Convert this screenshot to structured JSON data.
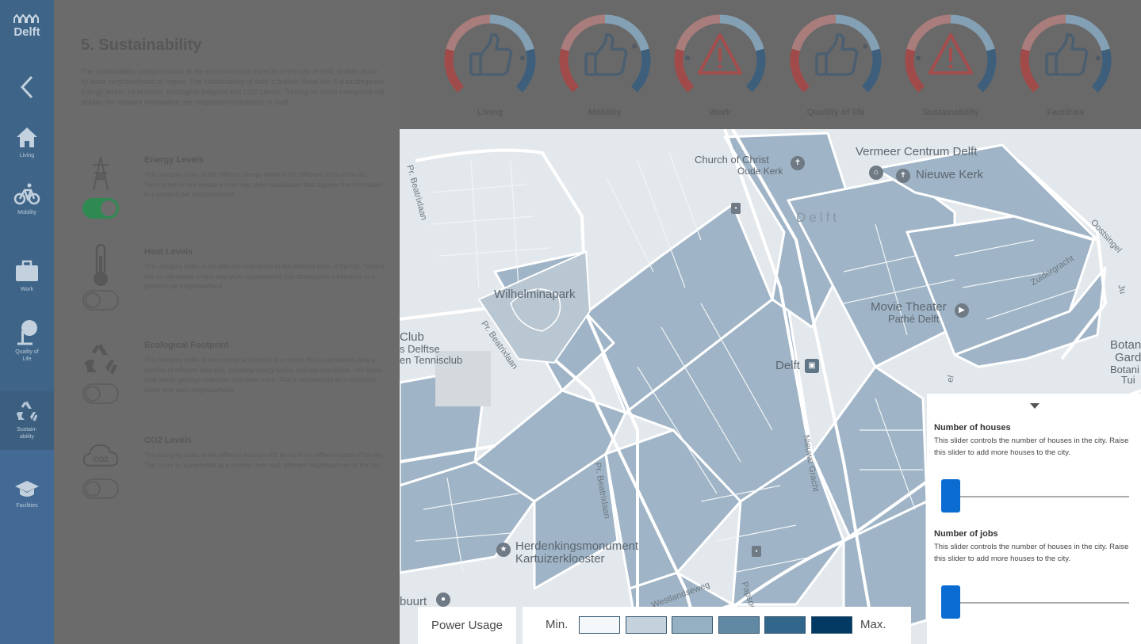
{
  "sidebar": {
    "logo_text": "Delft",
    "items": [
      {
        "label": "Living",
        "icon": "home-icon"
      },
      {
        "label": "Mobility",
        "icon": "bicycle-icon"
      },
      {
        "label": "Work",
        "icon": "briefcase-icon"
      },
      {
        "label": "Quality of Life",
        "icon": "tree-icon"
      },
      {
        "label": "Sustain-ability",
        "icon": "recycle-icon"
      },
      {
        "label": "Facilities",
        "icon": "graduation-cap-icon"
      }
    ]
  },
  "info": {
    "title": "5. Sustainability",
    "intro": "The sustainability category looks at the environmental aspects of the city of delft, broken down by each neighbourhood or region. The sustainability of delft is broken down into 4 subcategories. Energy levels, Heat levels, Ecological footprint and CO2 Levels. Turning on these categories will display the relevant information per neighbourhood/district of Delft",
    "categories": [
      {
        "title": "Energy Levels",
        "description": "This category looks at the different energy levels in the different parts of the city. Turning this on will enable a heat map style visualisation that displays the information in a gradient per neighbourhood",
        "enabled": true,
        "icon": "power-tower-icon"
      },
      {
        "title": "Heat Levels",
        "description": "This category looks at the different heat levels in the different parts of the city. Turning this on will enable a heat map style visualisations that displays the information in a gradient per neighbourhood.",
        "enabled": false,
        "icon": "thermometer-icon"
      },
      {
        "title": "Ecological Footprint",
        "description": "This category looks at the ecological footprint of a region, this is calculated using a number of different data sets, including energy levels, average population, c02 levels, heat levels, garbage collection and many more. This is represented as a numerical score over each neighbourhood.",
        "enabled": false,
        "icon": "recycle-icon"
      },
      {
        "title": "CO2 Levels",
        "description": "This category looks at the different average c02 levels of the different parts of the city. This score is represented as a number over each different neighbourhood of the city.",
        "enabled": false,
        "icon": "cloud-co2-icon",
        "icon_text": "CO2"
      }
    ]
  },
  "scores": [
    {
      "label": "Living",
      "status": "thumbs-up-icon",
      "level": 0.82
    },
    {
      "label": "Mobility",
      "status": "thumbs-up-icon",
      "level": 0.74
    },
    {
      "label": "Work",
      "status": "warning-icon",
      "level": 0.18
    },
    {
      "label": "Quallity of life",
      "status": "thumbs-up-icon",
      "level": 0.74
    },
    {
      "label": "Sustainability",
      "status": "warning-icon",
      "level": 0.18
    },
    {
      "label": "Facilities",
      "status": "thumbs-up-icon",
      "level": 0.82
    }
  ],
  "map": {
    "labels": {
      "church": "Church of Christ",
      "oude_kerk": "Oude Kerk",
      "vermeer": "Vermeer Centrum Delft",
      "nieuwe_kerk": "Nieuwe Kerk",
      "delft": "Delft",
      "wilhelminapark": "Wilhelminapark",
      "movie_theater": "Movie Theater",
      "pathe": "Pathé Delft",
      "delft_station": "Delft",
      "club1": "Club",
      "club2": "s Delftse",
      "club3": "en Tennisclub",
      "botan1": "Botan",
      "botan2": "Gard",
      "botan3": "Botani",
      "botan4": "Tui",
      "herdenking1": "Herdenkingsmonument",
      "herdenking2": "Kartuizerklooster",
      "buurt": "buurt"
    },
    "streets": {
      "beatrixlaan1": "Pr. Beatrixlaan",
      "beatrixlaan2": "Pr. Beatrixlaan",
      "beatrixlaan3": "Pr. Beatrixlaan",
      "nieuwe_gracht": "Nieuwe Gracht",
      "zuidergracht": "Zuidergracht",
      "oostsingel": "Oostsingel",
      "westlandseweg": "Westlandseweg",
      "papsouw": "Papsou",
      "ju": "Ju",
      "el": "el"
    }
  },
  "legend": {
    "title": "Power Usage",
    "min": "Min.",
    "max": "Max.",
    "colors": [
      "#f4f8fa",
      "#c3d2dd",
      "#94b0c2",
      "#6189a4",
      "#33668b",
      "#033a63"
    ]
  },
  "controls": [
    {
      "title": "Number of houses",
      "description": "This slider controls the number of houses in the city. Raise this slider to add more houses to the city.",
      "value": 0.0
    },
    {
      "title": "Number of jobs",
      "description": "This slider controls the number of houses in the city. Raise this slider to add more houses to the city.",
      "value": 0.0
    }
  ],
  "colors": {
    "accent": "#0a6bd1",
    "sidebar": "#3e6488"
  }
}
